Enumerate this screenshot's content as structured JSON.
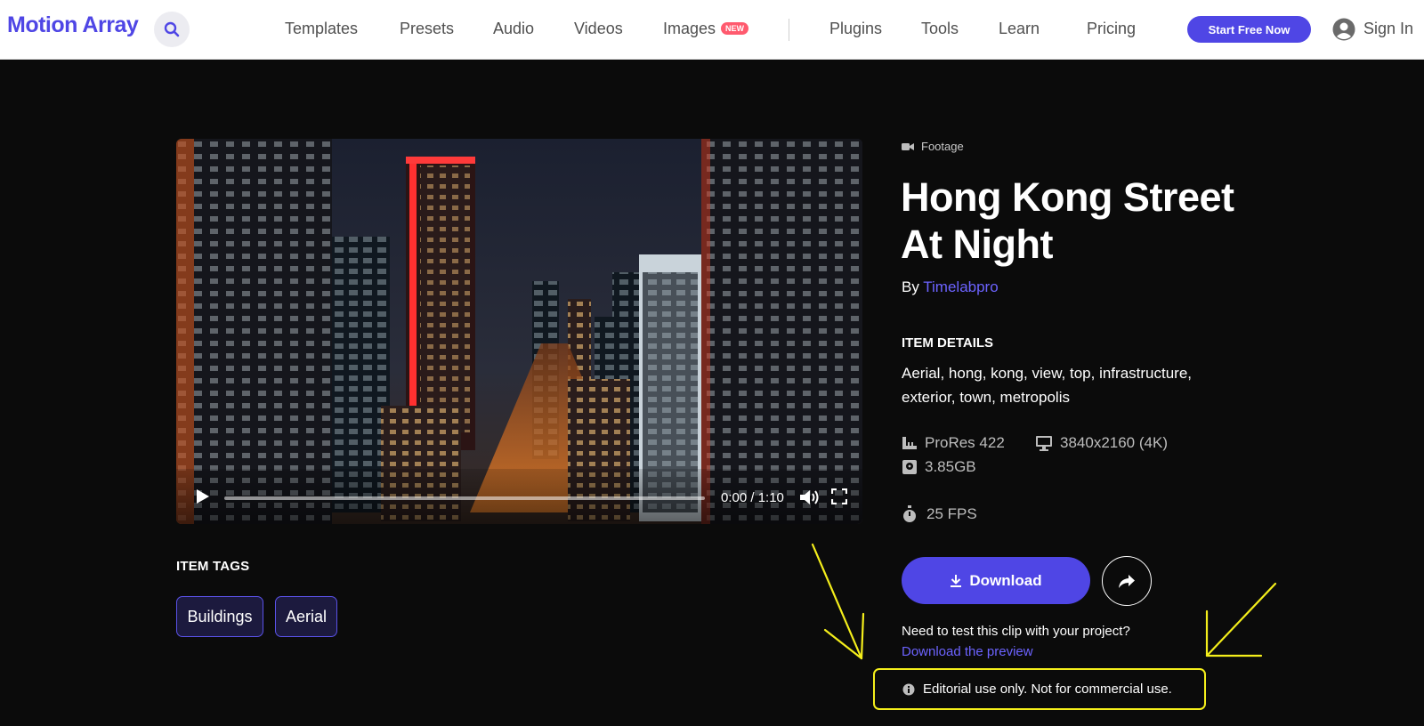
{
  "header": {
    "logo": "Motion Array",
    "nav": [
      "Templates",
      "Presets",
      "Audio",
      "Videos",
      "Images",
      "Plugins",
      "Tools",
      "Learn",
      "Pricing"
    ],
    "images_badge": "NEW",
    "start_button": "Start Free Now",
    "sign_in": "Sign In"
  },
  "video": {
    "time": "0:00 / 1:10",
    "progress": 0
  },
  "tags": {
    "heading": "ITEM TAGS",
    "items": [
      "Buildings",
      "Aerial"
    ]
  },
  "item": {
    "category": "Footage",
    "title": "Hong Kong Street At Night",
    "by_label": "By",
    "author": "Timelabpro",
    "details_heading": "ITEM DETAILS",
    "keywords": "Aerial, hong, kong, view, top, infrastructure, exterior, town, metropolis",
    "specs": {
      "codec": "ProRes 422",
      "resolution": "3840x2160 (4K)",
      "size": "3.85GB",
      "fps": "25 FPS"
    },
    "download_label": "Download",
    "preview_question": "Need to test this clip with your project?",
    "preview_link": "Download the preview",
    "editorial_notice": "Editorial use only. Not for commercial use."
  },
  "colors": {
    "accent": "#4f46e5",
    "link": "#6c63ff",
    "annotation": "#f4ee1b",
    "background": "#0b0b0b"
  }
}
